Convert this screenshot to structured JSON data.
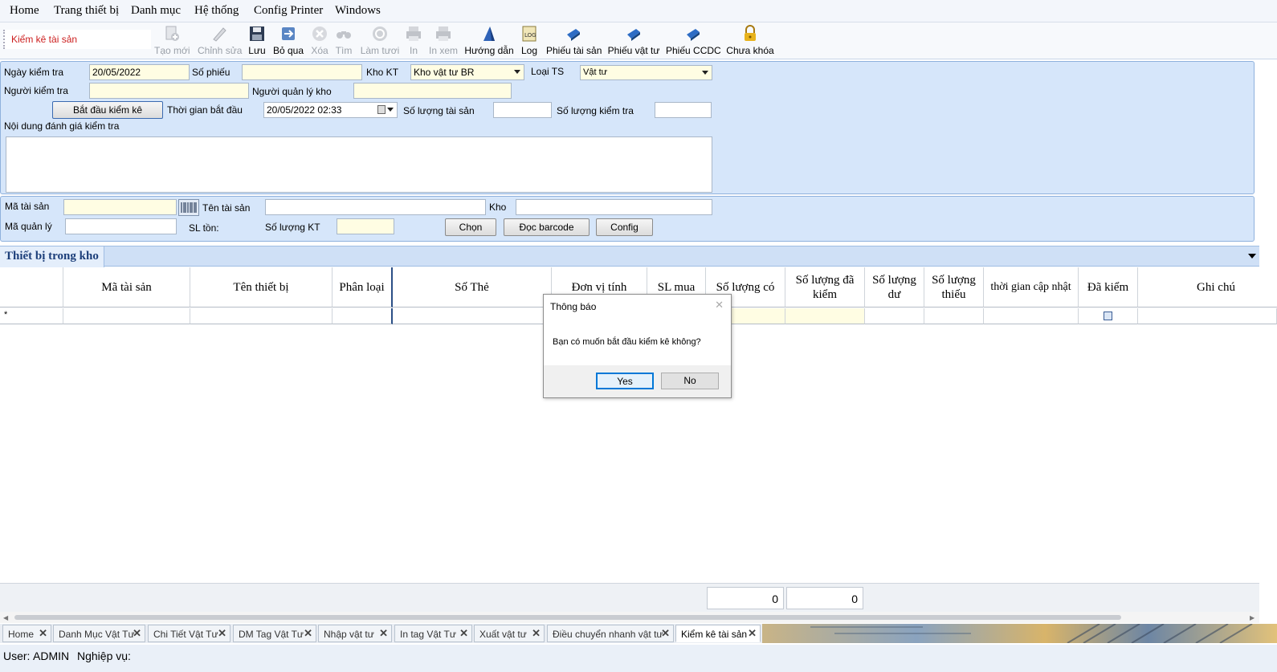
{
  "menu": [
    "Home",
    "Trang thiết bị",
    "Danh mục",
    "Hệ thống",
    "Config Printer",
    "Windows"
  ],
  "toolbar": {
    "title": "Kiểm kê tài sản",
    "buttons": [
      {
        "label": "Tạo mới",
        "icon": "new-icon",
        "enabled": false
      },
      {
        "label": "Chỉnh sửa",
        "icon": "edit-icon",
        "enabled": false
      },
      {
        "label": "Lưu",
        "icon": "save-icon",
        "enabled": true
      },
      {
        "label": "Bỏ qua",
        "icon": "skip-icon",
        "enabled": true
      },
      {
        "label": "Xóa",
        "icon": "delete-icon",
        "enabled": false
      },
      {
        "label": "Tìm",
        "icon": "binoculars-icon",
        "enabled": false
      },
      {
        "label": "Làm tươi",
        "icon": "refresh-icon",
        "enabled": false
      },
      {
        "label": "In",
        "icon": "print-icon",
        "enabled": false
      },
      {
        "label": "In xem",
        "icon": "print-preview-icon",
        "enabled": false
      },
      {
        "label": "Hướng dẫn",
        "icon": "guide-icon",
        "enabled": true
      },
      {
        "label": "Log",
        "icon": "log-icon",
        "enabled": true
      },
      {
        "label": "Phiếu tài sản",
        "icon": "asset-slip-icon",
        "enabled": true
      },
      {
        "label": "Phiếu vật tư",
        "icon": "material-slip-icon",
        "enabled": true
      },
      {
        "label": "Phiếu CCDC",
        "icon": "tool-slip-icon",
        "enabled": true
      },
      {
        "label": "Chưa khóa",
        "icon": "lock-icon",
        "enabled": true
      }
    ]
  },
  "form": {
    "ngay_kiem_tra_label": "Ngày kiểm tra",
    "ngay_kiem_tra": "20/05/2022",
    "so_phieu_label": "Số phiếu",
    "so_phieu": "",
    "kho_kt_label": "Kho KT",
    "kho_kt": "Kho vật tư BR",
    "loai_ts_label": "Loại TS",
    "loai_ts": "Vật tư",
    "nguoi_kiem_tra_label": "Người kiểm tra",
    "nguoi_kiem_tra": "",
    "nguoi_quan_ly_kho_label": "Người quản lý kho",
    "nguoi_quan_ly_kho": "",
    "bat_dau_button": "Bắt đầu kiểm kê",
    "thoi_gian_bat_dau_label": "Thời gian bắt đầu",
    "thoi_gian_bat_dau": "20/05/2022 02:33",
    "so_luong_tai_san_label": "Số lượng tài sản",
    "so_luong_tai_san": "",
    "so_luong_kiem_tra_label": "Số lượng kiểm tra",
    "so_luong_kiem_tra": "",
    "noi_dung_label": "Nội dung đánh giá kiểm tra",
    "noi_dung": ""
  },
  "search": {
    "ma_tai_san_label": "Mã tài sản",
    "ma_tai_san": "",
    "ten_tai_san_label": "Tên tài sản",
    "ten_tai_san": "",
    "kho_label": "Kho",
    "kho": "",
    "ma_quan_ly_label": "Mã quản lý",
    "ma_quan_ly": "",
    "sl_ton_label": "SL tồn:",
    "so_luong_kt_label": "Số lượng KT",
    "so_luong_kt": "",
    "chon_button": "Chọn",
    "doc_barcode_button": "Đọc barcode",
    "config_button": "Config"
  },
  "grid": {
    "tab_title": "Thiết bị trong kho",
    "columns": [
      "Mã tài sản",
      "Tên thiết bị",
      "Phân loại",
      "Số Thẻ",
      "Đơn vị tính",
      "SL mua",
      "Số lượng có",
      "Số lượng đã kiểm",
      "Số lượng dư",
      "Số lượng thiếu",
      "thời gian cập nhật",
      "Đã kiểm",
      "Ghi chú"
    ],
    "new_row_marker": "*"
  },
  "totals": [
    "0",
    "0"
  ],
  "window_tabs": [
    {
      "label": "Home",
      "active": false
    },
    {
      "label": "Danh Mục Vật Tư",
      "active": false
    },
    {
      "label": "Chi Tiết Vật Tư",
      "active": false
    },
    {
      "label": "DM Tag Vật Tư",
      "active": false
    },
    {
      "label": "Nhập vật tư",
      "active": false
    },
    {
      "label": "In tag Vật Tư",
      "active": false
    },
    {
      "label": "Xuất vật tư",
      "active": false
    },
    {
      "label": "Điều chuyển nhanh vật tư",
      "active": false
    },
    {
      "label": "Kiểm kê tài sản",
      "active": true
    }
  ],
  "status": {
    "user_label": "User:",
    "user": "ADMIN",
    "nghiep_vu_label": "Nghiệp vụ:"
  },
  "dialog": {
    "title": "Thông báo",
    "message": "Bạn có muốn bắt đầu kiểm kê không?",
    "yes": "Yes",
    "no": "No"
  },
  "colors": {
    "accent": "#cc1f1f",
    "panel": "#d6e6fa",
    "input_yellow": "#fffde3"
  }
}
